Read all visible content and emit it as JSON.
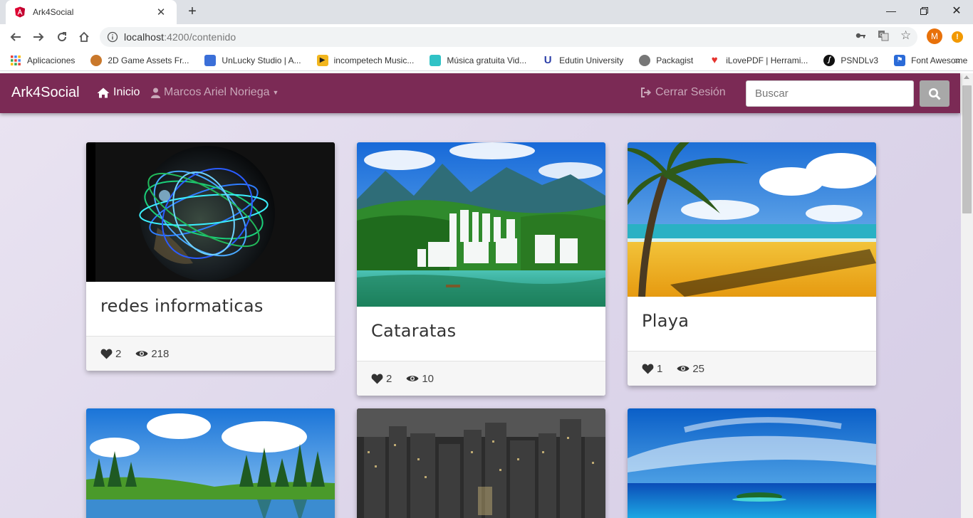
{
  "browser": {
    "tab_title": "Ark4Social",
    "url_host": "localhost",
    "url_rest": ":4200/contenido",
    "profile_initial": "M",
    "update_badge": "!",
    "bookmarks": [
      {
        "label": "Aplicaciones",
        "icon": "apps-grid-icon",
        "color": "#4285f4"
      },
      {
        "label": "2D Game Assets Fr...",
        "icon": "game-assets-icon",
        "color": "#c9782b"
      },
      {
        "label": "UnLucky Studio | A...",
        "icon": "unlucky-studio-icon",
        "color": "#3b6fd8"
      },
      {
        "label": "incompetech Music...",
        "icon": "play-icon",
        "color": "#f2b61e"
      },
      {
        "label": "Música gratuita Vid...",
        "icon": "music-icon",
        "color": "#30c2c6"
      },
      {
        "label": "Edutin University",
        "icon": "edutin-icon",
        "color": "#2c3fa8"
      },
      {
        "label": "Packagist",
        "icon": "packagist-icon",
        "color": "#777777"
      },
      {
        "label": "iLovePDF | Herrami...",
        "icon": "ilovepdf-icon",
        "color": "#e5322d"
      },
      {
        "label": "PSNDLv3",
        "icon": "symfony-icon",
        "color": "#111111"
      },
      {
        "label": "Font Awesome",
        "icon": "flag-icon",
        "color": "#2b6bd8"
      }
    ]
  },
  "navbar": {
    "brand": "Ark4Social",
    "home_label": "Inicio",
    "user_label": "Marcos Ariel Noriega",
    "logout_label": "Cerrar Sesión",
    "search_placeholder": "Buscar",
    "background": "#7b2a55"
  },
  "posts": [
    {
      "title": "redes informaticas",
      "likes": "2",
      "views": "218",
      "image": "globe-network"
    },
    {
      "title": "Cataratas",
      "likes": "2",
      "views": "10",
      "image": "waterfalls"
    },
    {
      "title": "Playa",
      "likes": "1",
      "views": "25",
      "image": "beach"
    },
    {
      "title": "",
      "likes": "",
      "views": "",
      "image": "lake-forest"
    },
    {
      "title": "",
      "likes": "",
      "views": "",
      "image": "city-night"
    },
    {
      "title": "",
      "likes": "",
      "views": "",
      "image": "tropical-island"
    }
  ]
}
